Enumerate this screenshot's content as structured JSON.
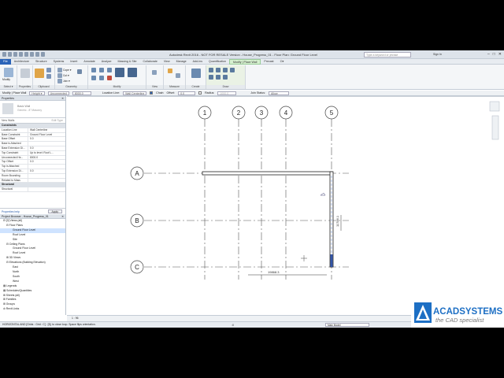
{
  "titlebar": {
    "title": "Autodesk Revit 2016 - NOT FOR RESALE Version -   House_Progress_01 - Floor Plan: Ground Floor Level",
    "search_placeholder": "Type a keyword or phrase",
    "user": "Sign In"
  },
  "tabs": [
    {
      "label": "File"
    },
    {
      "label": "Architecture"
    },
    {
      "label": "Structure"
    },
    {
      "label": "Systems"
    },
    {
      "label": "Insert"
    },
    {
      "label": "Annotate"
    },
    {
      "label": "Analyze"
    },
    {
      "label": "Massing & Site"
    },
    {
      "label": "Collaborate"
    },
    {
      "label": "View"
    },
    {
      "label": "Manage"
    },
    {
      "label": "Add-Ins"
    },
    {
      "label": "Quantification"
    },
    {
      "label": "Modify | Place Wall"
    },
    {
      "label": "Precast"
    },
    {
      "label": "⊡▾"
    }
  ],
  "ribbon": {
    "groups": [
      {
        "label": "Select ▾"
      },
      {
        "label": "Properties"
      },
      {
        "label": "Clipboard"
      },
      {
        "label": "Geometry"
      },
      {
        "label": "Modify"
      },
      {
        "label": "View"
      },
      {
        "label": "Measure"
      },
      {
        "label": "Create"
      },
      {
        "label": "Draw"
      }
    ],
    "modify_label": "Modify",
    "cope_label": "Cope ▾",
    "cut_label": "Cut ▾",
    "join_label": "Join ▾"
  },
  "contextbar": {
    "mode": "Modify | Place Wall",
    "height_label": "Height ▾",
    "height_value": "Unconnected",
    "height_dim": "8000.0",
    "locline_label": "Location Line:",
    "locline_value": "Wall Centerline",
    "chain_label": "Chain",
    "offset_label": "Offset:",
    "offset_value": "0.0",
    "radius_label": "Radius:",
    "radius_value": "1000.0",
    "join_label": "Join Status:",
    "join_value": "Allow"
  },
  "properties": {
    "header": "Properties",
    "family": "Basic Wall",
    "type": "Generic - 8\" Masonry",
    "selector": "New Walls",
    "edit_type": "Edit Type",
    "categories": [
      {
        "name": "Constraints",
        "rows": [
          {
            "k": "Location Line",
            "v": "Wall Centerline"
          },
          {
            "k": "Base Constraint",
            "v": "Ground Floor Level"
          },
          {
            "k": "Base Offset",
            "v": "0.0"
          },
          {
            "k": "Base is Attached",
            "v": ""
          },
          {
            "k": "Base Extension Di...",
            "v": "0.0"
          },
          {
            "k": "Top Constraint",
            "v": "Up to level: Roof L..."
          },
          {
            "k": "Unconnected He...",
            "v": "8000.0"
          },
          {
            "k": "Top Offset",
            "v": "0.0"
          },
          {
            "k": "Top is Attached",
            "v": ""
          },
          {
            "k": "Top Extension Di...",
            "v": "0.0"
          },
          {
            "k": "Room Bounding",
            "v": ""
          },
          {
            "k": "Related to Mass",
            "v": ""
          }
        ]
      },
      {
        "name": "Structural",
        "rows": [
          {
            "k": "Structural",
            "v": ""
          }
        ]
      }
    ],
    "help_link": "Properties help",
    "apply": "Apply"
  },
  "browser": {
    "header": "Project Browser - House_Progress_01",
    "items": [
      {
        "label": "⊟ [0] Views (all)",
        "indent": 1,
        "selected": false
      },
      {
        "label": "⊟ Floor Plans",
        "indent": 2,
        "selected": false
      },
      {
        "label": "Ground Floor Level",
        "indent": 4,
        "selected": true
      },
      {
        "label": "Roof Level",
        "indent": 4,
        "selected": false
      },
      {
        "label": "Site",
        "indent": 4,
        "selected": false
      },
      {
        "label": "⊟ Ceiling Plans",
        "indent": 2,
        "selected": false
      },
      {
        "label": "Ground Floor Level",
        "indent": 4,
        "selected": false
      },
      {
        "label": "Roof Level",
        "indent": 4,
        "selected": false
      },
      {
        "label": "⊞ 3D Views",
        "indent": 2,
        "selected": false
      },
      {
        "label": "⊟ Elevations (Building Elevation)",
        "indent": 2,
        "selected": false
      },
      {
        "label": "East",
        "indent": 4,
        "selected": false
      },
      {
        "label": "North",
        "indent": 4,
        "selected": false
      },
      {
        "label": "South",
        "indent": 4,
        "selected": false
      },
      {
        "label": "West",
        "indent": 4,
        "selected": false
      },
      {
        "label": "▤ Legends",
        "indent": 1,
        "selected": false
      },
      {
        "label": "▤ Schedules/Quantities",
        "indent": 1,
        "selected": false
      },
      {
        "label": "⊞ Sheets (all)",
        "indent": 1,
        "selected": false
      },
      {
        "label": "⊞ Families",
        "indent": 1,
        "selected": false
      },
      {
        "label": "⊞ Groups",
        "indent": 1,
        "selected": false
      },
      {
        "label": "⊘ Revit Links",
        "indent": 1,
        "selected": false
      }
    ]
  },
  "canvas": {
    "grids_vertical": [
      "1",
      "2",
      "3",
      "4",
      "5"
    ],
    "grids_horizontal": [
      "A",
      "B",
      "C"
    ],
    "temp_dim_horizontal": "19868.3",
    "temp_dim_vertical": "11786.1"
  },
  "viewctrl": {
    "scale": "1 : 96"
  },
  "statusbar": {
    "hint": "HORIZONTAL AND [Grids : Grid : C] : [5]; to close loop. Space flips orientation.",
    "zero": ":0",
    "model": "Main Model"
  },
  "logo": {
    "brand": "ACADSYSTEMS",
    "tagline": "the CAD specialist",
    "colors": {
      "blue": "#1d6fc4",
      "grey": "#777777"
    }
  }
}
